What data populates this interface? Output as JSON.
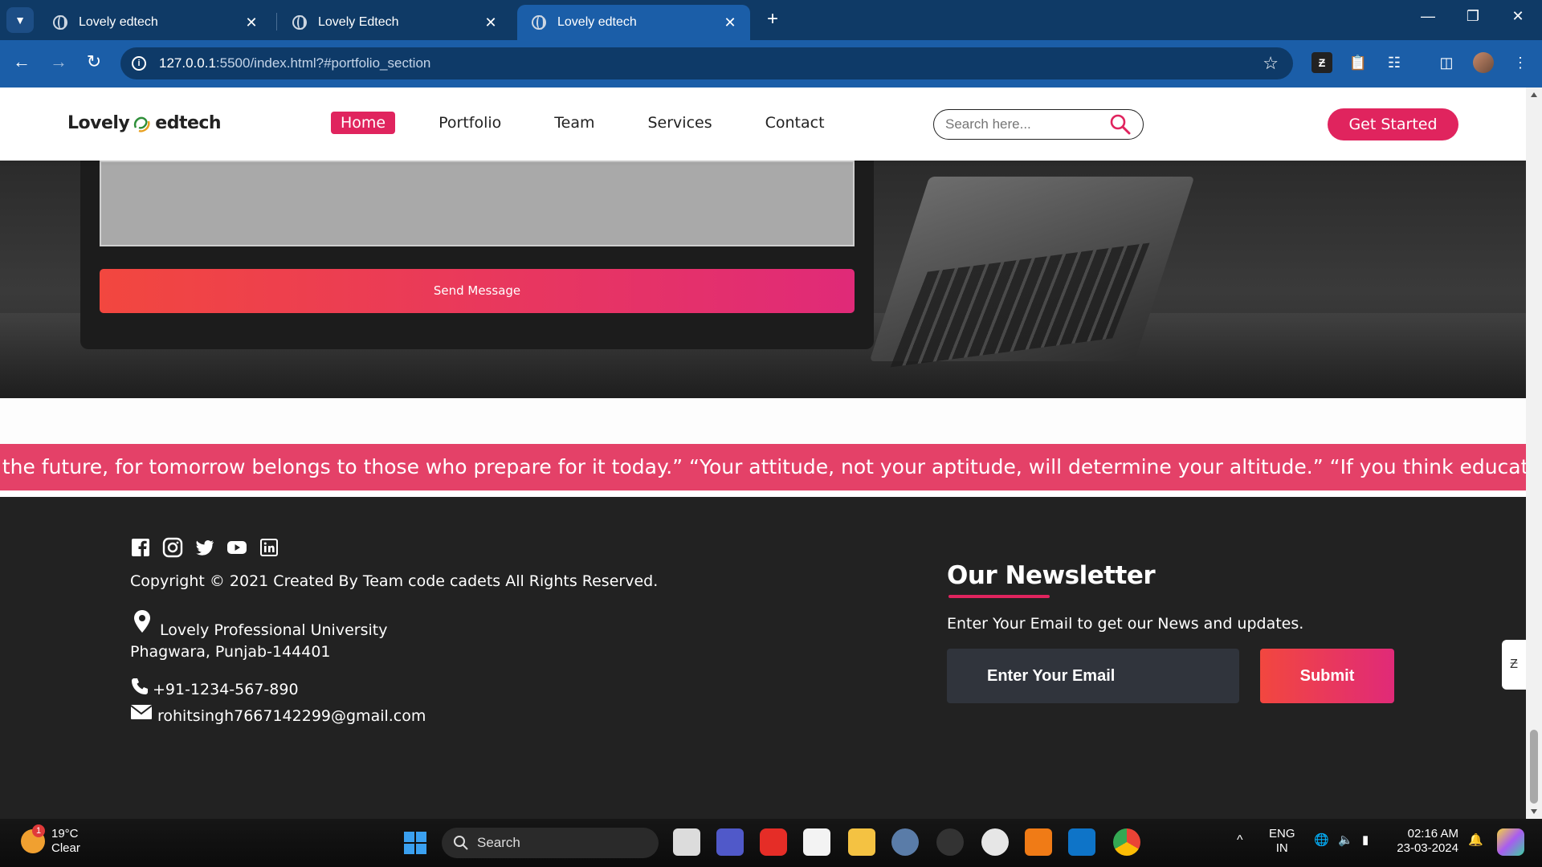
{
  "browser": {
    "tabs": [
      {
        "title": "Lovely edtech",
        "active": false
      },
      {
        "title": "Lovely Edtech",
        "active": false
      },
      {
        "title": "Lovely edtech",
        "active": true
      }
    ],
    "url_host": "127.0.0.1",
    "url_rest": ":5500/index.html?#portfolio_section"
  },
  "header": {
    "logo_left": "Lovely",
    "logo_right": "edtech",
    "nav": [
      "Home",
      "Portfolio",
      "Team",
      "Services",
      "Contact"
    ],
    "active_nav": "Home",
    "search_placeholder": "Search here...",
    "cta": "Get Started"
  },
  "contact": {
    "send_label": "Send Message"
  },
  "marquee": {
    "text": "t to the future, for tomorrow belongs to those who prepare for it today.” “Your attitude, not your aptitude, will determine your altitude.” “If you think education is exp"
  },
  "footer": {
    "socials": [
      "facebook-icon",
      "instagram-icon",
      "twitter-icon",
      "youtube-icon",
      "linkedin-icon"
    ],
    "copyright": "Copyright © 2021 Created By Team code cadets All Rights Reserved.",
    "address_line1": "Lovely Professional University",
    "address_line2": "Phagwara, Punjab-144401",
    "phone": "+91-1234-567-890",
    "email": "rohitsingh7667142299@gmail.com",
    "newsletter_title": "Our Newsletter",
    "newsletter_desc": "Enter Your Email to get our News and updates.",
    "email_placeholder": "Enter Your Email",
    "submit_label": "Submit"
  },
  "taskbar": {
    "weather_temp": "19°C",
    "weather_desc": "Clear",
    "weather_badge": "1",
    "search_label": "Search",
    "lang_top": "ENG",
    "lang_bottom": "IN",
    "time": "02:16 AM",
    "date": "23-03-2024"
  },
  "colors": {
    "accent": "#e0245e",
    "browser_dark": "#0f3a66",
    "browser_blue": "#1b5ea8",
    "footer_bg": "#222222"
  }
}
